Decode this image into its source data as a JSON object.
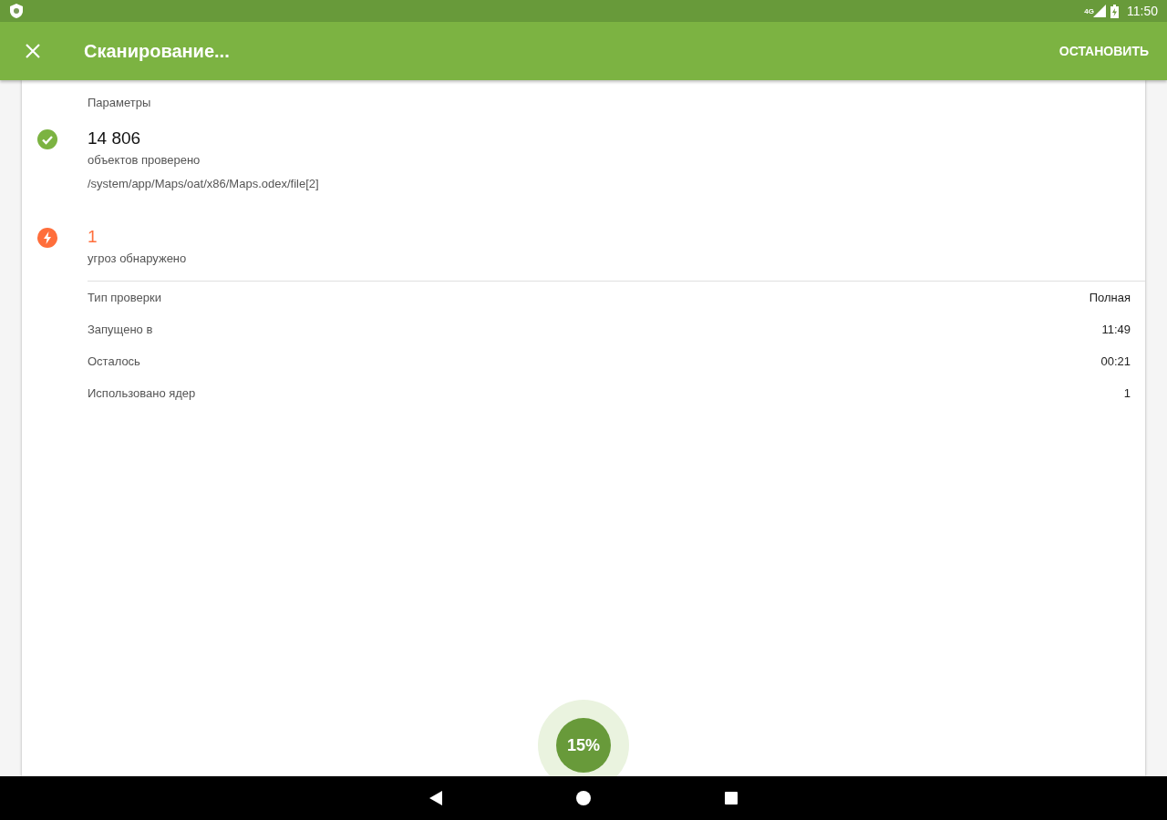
{
  "status_bar": {
    "network": "4G",
    "time": "11:50"
  },
  "app_bar": {
    "title": "Сканирование...",
    "action": "ОСТАНОВИТЬ"
  },
  "section_title": "Параметры",
  "stats": [
    {
      "kind": "ok",
      "value": "14 806",
      "label": "объектов проверено",
      "detail": "/system/app/Maps/oat/x86/Maps.odex/file[2]"
    },
    {
      "kind": "threat",
      "value": "1",
      "label": "угроз обнаружено"
    }
  ],
  "details": [
    {
      "label": "Тип проверки",
      "value": "Полная"
    },
    {
      "label": "Запущено в",
      "value": "11:49"
    },
    {
      "label": "Осталось",
      "value": "00:21"
    },
    {
      "label": "Использовано ядер",
      "value": "1"
    }
  ],
  "progress": {
    "text": "15%"
  }
}
